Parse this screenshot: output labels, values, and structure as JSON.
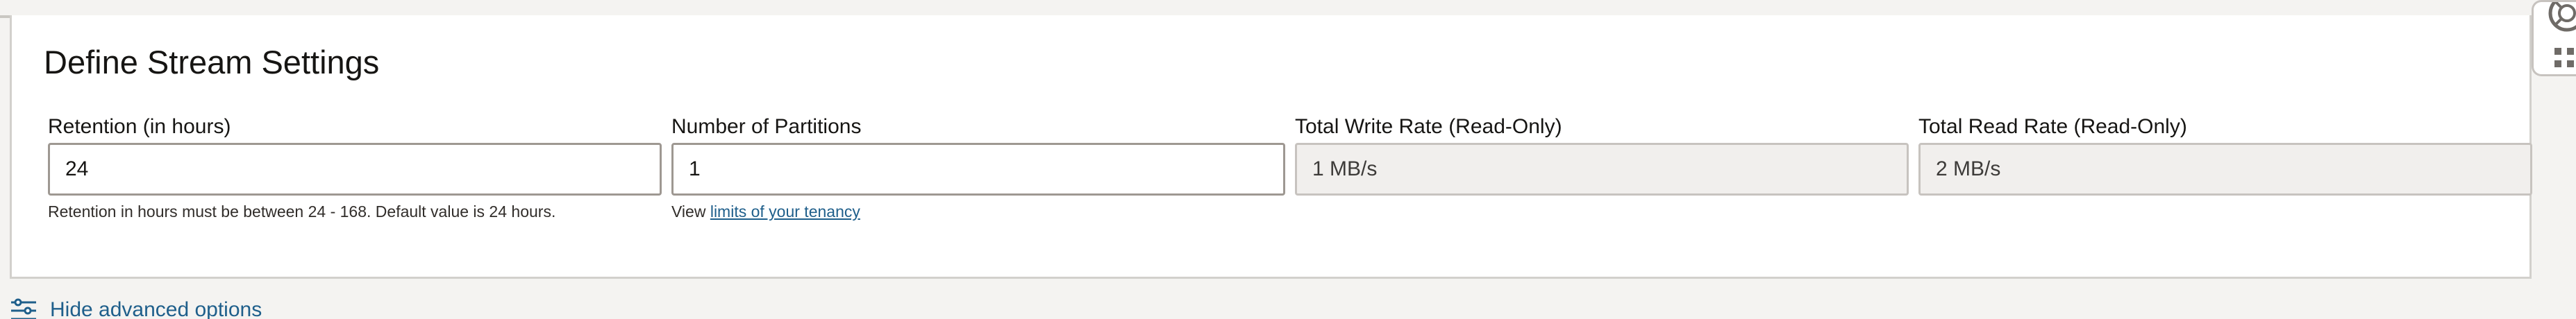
{
  "panel": {
    "title": "Define Stream Settings"
  },
  "fields": {
    "retention": {
      "label": "Retention (in hours)",
      "value": "24",
      "help": "Retention in hours must be between 24 - 168. Default value is 24 hours."
    },
    "partitions": {
      "label": "Number of Partitions",
      "value": "1",
      "help_prefix": "View",
      "help_link": "limits of your tenancy"
    },
    "write_rate": {
      "label": "Total Write Rate (Read-Only)",
      "value": "1 MB/s"
    },
    "read_rate": {
      "label": "Total Read Rate (Read-Only)",
      "value": "2 MB/s"
    }
  },
  "advanced": {
    "label": "Hide advanced options",
    "icon": "filter-options-icon"
  },
  "side_widget": {
    "icons": [
      "help-lifebuoy-icon",
      "apps-grid-icon"
    ]
  },
  "colors": {
    "link": "#1f5f8b",
    "text": "#161513",
    "readonly_bg": "#f1efed",
    "page_bg": "#f4f3f1"
  }
}
